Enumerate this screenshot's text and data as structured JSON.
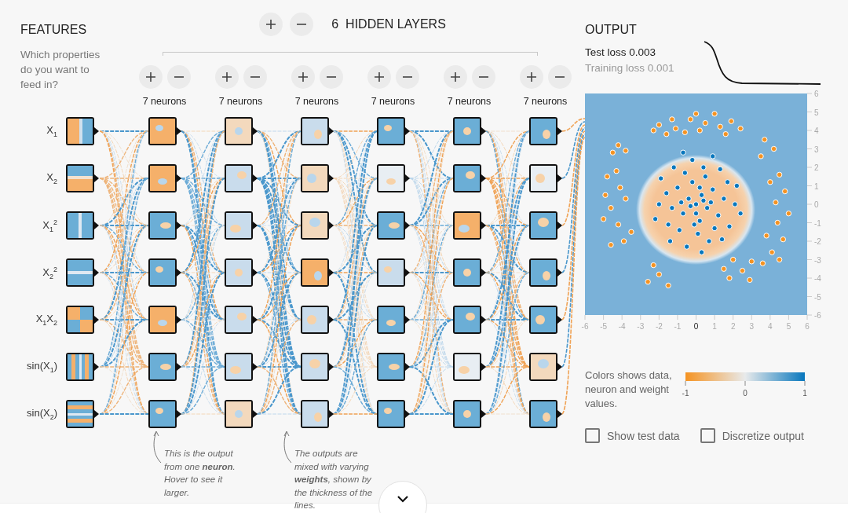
{
  "features": {
    "title": "FEATURES",
    "description": "Which properties do you want to feed in?",
    "inputs": [
      {
        "label": "X$_{1}$",
        "kind": "vsplit"
      },
      {
        "label": "X$_{2}$",
        "kind": "hsplit"
      },
      {
        "label": "X$_{1}$$^{2}$",
        "kind": "vline"
      },
      {
        "label": "X$_{2}$$^{2}$",
        "kind": "hline"
      },
      {
        "label": "X$_{1}$X$_{2}$",
        "kind": "quadrants"
      },
      {
        "label": "sin(X$_{1}$)",
        "kind": "vwaves"
      },
      {
        "label": "sin(X$_{2}$)",
        "kind": "hwaves"
      }
    ]
  },
  "hidden": {
    "count": "6",
    "title": "HIDDEN LAYERS",
    "layers": [
      {
        "label": "7 neurons",
        "nodes": [
          {
            "color": "#f5b06a"
          },
          {
            "color": "#f5b06a"
          },
          {
            "color": "#6baed6"
          },
          {
            "color": "#6baed6"
          },
          {
            "color": "#f5b06a"
          },
          {
            "color": "#6baed6"
          },
          {
            "color": "#6baed6"
          }
        ]
      },
      {
        "label": "7 neurons",
        "nodes": [
          {
            "color": "#f3d9bd"
          },
          {
            "color": "#c9dcec"
          },
          {
            "color": "#c9dcec"
          },
          {
            "color": "#c9dcec"
          },
          {
            "color": "#c9dcec"
          },
          {
            "color": "#c9dcec"
          },
          {
            "color": "#f3d9bd"
          }
        ]
      },
      {
        "label": "7 neurons",
        "nodes": [
          {
            "color": "#c9dcec"
          },
          {
            "color": "#f3d9bd"
          },
          {
            "color": "#f3d9bd"
          },
          {
            "color": "#f5b06a"
          },
          {
            "color": "#c9dcec"
          },
          {
            "color": "#c9dcec"
          },
          {
            "color": "#c9dcec"
          }
        ]
      },
      {
        "label": "7 neurons",
        "nodes": [
          {
            "color": "#6baed6"
          },
          {
            "color": "#e8eef3"
          },
          {
            "color": "#6baed6"
          },
          {
            "color": "#c9dcec"
          },
          {
            "color": "#6baed6"
          },
          {
            "color": "#6baed6"
          },
          {
            "color": "#6baed6"
          }
        ]
      },
      {
        "label": "7 neurons",
        "nodes": [
          {
            "color": "#6baed6"
          },
          {
            "color": "#6baed6"
          },
          {
            "color": "#f5b06a"
          },
          {
            "color": "#6baed6"
          },
          {
            "color": "#6baed6"
          },
          {
            "color": "#e8eef3"
          },
          {
            "color": "#6baed6"
          }
        ]
      },
      {
        "label": "7 neurons",
        "nodes": [
          {
            "color": "#6baed6"
          },
          {
            "color": "#e8eef3"
          },
          {
            "color": "#6baed6"
          },
          {
            "color": "#6baed6"
          },
          {
            "color": "#6baed6"
          },
          {
            "color": "#f3d9bd"
          },
          {
            "color": "#6baed6"
          }
        ]
      }
    ]
  },
  "notes": [
    {
      "text": "This is the output from one **neuron**. Hover to see it larger."
    },
    {
      "text": "The outputs are mixed with varying **weights**, shown by the thickness of the lines."
    }
  ],
  "output": {
    "title": "OUTPUT",
    "test_loss": "Test loss 0.003",
    "training_loss": "Training loss 0.001",
    "chart_data": {
      "type": "scatter",
      "xlim": [
        -6,
        6
      ],
      "ylim": [
        -6,
        6
      ],
      "xticks": [
        -6,
        -5,
        -4,
        -3,
        -2,
        -1,
        0,
        1,
        2,
        3,
        4,
        5,
        6
      ],
      "yticks": [
        -6,
        -5,
        -4,
        -3,
        -2,
        -1,
        0,
        1,
        2,
        3,
        4,
        5,
        6
      ],
      "series": [
        {
          "color": "#f59322",
          "x": [
            -2,
            -2.3,
            -1.3,
            -1.1,
            -0.3,
            0,
            -0.6,
            0.5,
            1,
            1.3,
            1.9,
            2.4,
            0.2,
            -1.6,
            1.6,
            -4.5,
            -4.2,
            -3.8,
            -4.8,
            -4.3,
            -4.9,
            -4.1,
            -4.6,
            -3.8,
            -5.0,
            -4.2,
            -3.9,
            -4.6,
            -3.5,
            3.7,
            4.2,
            3.5,
            4.5,
            4.0,
            4.8,
            4.3,
            5.0,
            4.4,
            3.8,
            4.7,
            4.1,
            3.6,
            4.5,
            -2.3,
            -2.0,
            -2.6,
            -1.5,
            1.5,
            2.0,
            2.5,
            3.0,
            1.8,
            2.9
          ],
          "values": [
            4.3,
            4.0,
            4.6,
            4.1,
            4.6,
            4.9,
            3.9,
            4.4,
            4.9,
            4.2,
            4.5,
            4.1,
            4.0,
            3.8,
            3.8,
            2.8,
            3.2,
            2.9,
            1.5,
            1.8,
            0.5,
            0.9,
            -0.2,
            0.3,
            -0.8,
            -1.1,
            -2.0,
            -2.2,
            -1.5,
            3.5,
            3.0,
            2.6,
            1.6,
            1.2,
            0.7,
            0.1,
            -0.5,
            -1.0,
            -1.7,
            -1.9,
            -2.6,
            -3.2,
            -3.0,
            -3.3,
            -3.8,
            -4.2,
            -4.4,
            -3.5,
            -3.0,
            -3.6,
            -3.1,
            -4.0,
            -4.1
          ]
        },
        {
          "color": "#0877bd",
          "x": [
            0,
            0.3,
            -0.4,
            0.6,
            -0.7,
            0.2,
            -0.2,
            0.9,
            -1.0,
            1.2,
            -1.3,
            0.5,
            -0.6,
            1.5,
            -1.6,
            0.1,
            -0.9,
            1.0,
            1.7,
            -1.5,
            0.4,
            -0.2,
            1.3,
            -1.2,
            2.1,
            -2.0,
            0.7,
            -0.5,
            1.8,
            -1.9,
            0.0,
            -0.3,
            0.4,
            0.8,
            -0.8,
            0.2,
            -0.1,
            1.4,
            -1.4,
            2.2,
            -2.2,
            0.9,
            -0.7,
            0.3,
            2.4
          ],
          "values": [
            0,
            0.5,
            0.3,
            -0.2,
            -0.5,
            -0.9,
            1.2,
            0.8,
            0.9,
            -0.6,
            -0.2,
            1.5,
            1.7,
            0.3,
            0.6,
            -1.6,
            -1.4,
            -1.3,
            1.2,
            -1.1,
            2.0,
            2.4,
            1.9,
            2.0,
            0.0,
            0.0,
            -2.0,
            -2.3,
            -1.2,
            1.4,
            -0.5,
            -0.1,
            0.2,
            0.1,
            0.1,
            0.9,
            -1.1,
            -1.9,
            -2.0,
            1.0,
            -0.8,
            2.6,
            2.8,
            -2.6,
            -0.5
          ]
        }
      ]
    },
    "legend": {
      "text": "Colors shows data, neuron and weight values.",
      "ticks": [
        "-1",
        "0",
        "1"
      ]
    },
    "options": [
      {
        "label": "Show test data",
        "checked": false
      },
      {
        "label": "Discretize output",
        "checked": false
      }
    ]
  }
}
